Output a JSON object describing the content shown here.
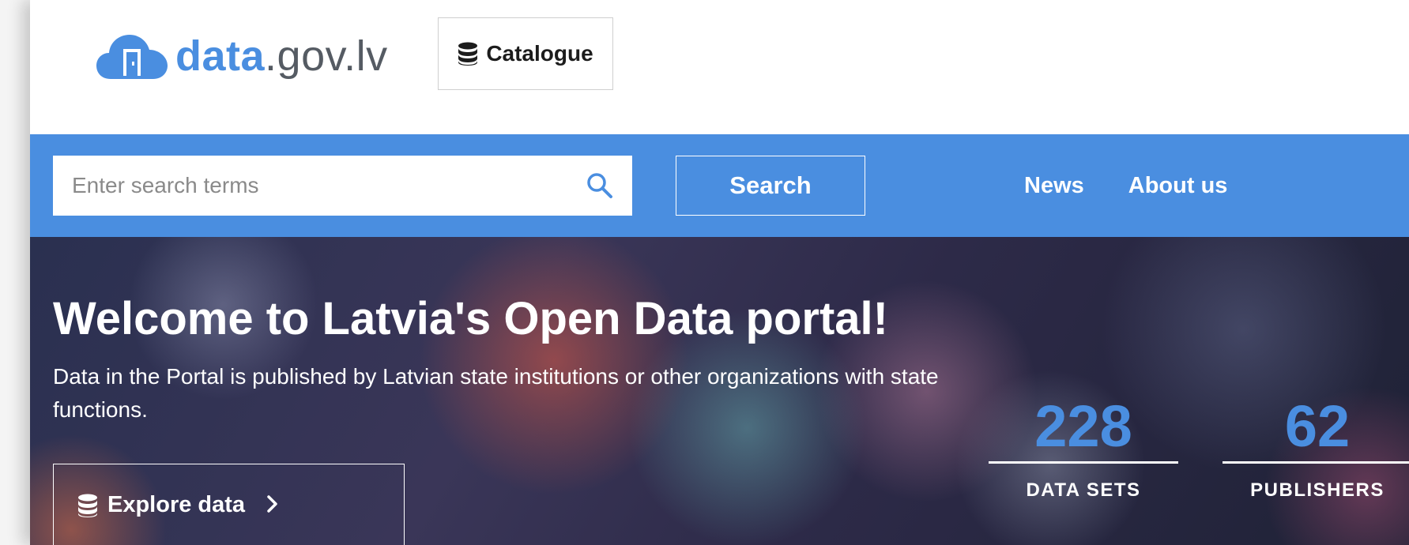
{
  "header": {
    "logo": {
      "bold": "data",
      "rest": ".gov.lv",
      "icon": "cloud-door-icon"
    },
    "catalogue_label": "Catalogue",
    "catalogue_icon": "database-icon"
  },
  "search": {
    "placeholder": "Enter search terms",
    "value": "",
    "button_label": "Search",
    "icon": "search-icon"
  },
  "nav": {
    "items": [
      {
        "label": "News"
      },
      {
        "label": "About us"
      }
    ]
  },
  "hero": {
    "title": "Welcome to Latvia's Open Data portal!",
    "description": "Data in the Portal is published by Latvian state institutions or other organizations with state functions.",
    "explore_label": "Explore data",
    "explore_icon": "database-icon"
  },
  "stats": [
    {
      "value": "228",
      "label": "DATA SETS"
    },
    {
      "value": "62",
      "label": "PUBLISHERS"
    }
  ],
  "colors": {
    "brand_blue": "#4a8ee0",
    "logo_grey": "#555b63",
    "white": "#ffffff"
  }
}
